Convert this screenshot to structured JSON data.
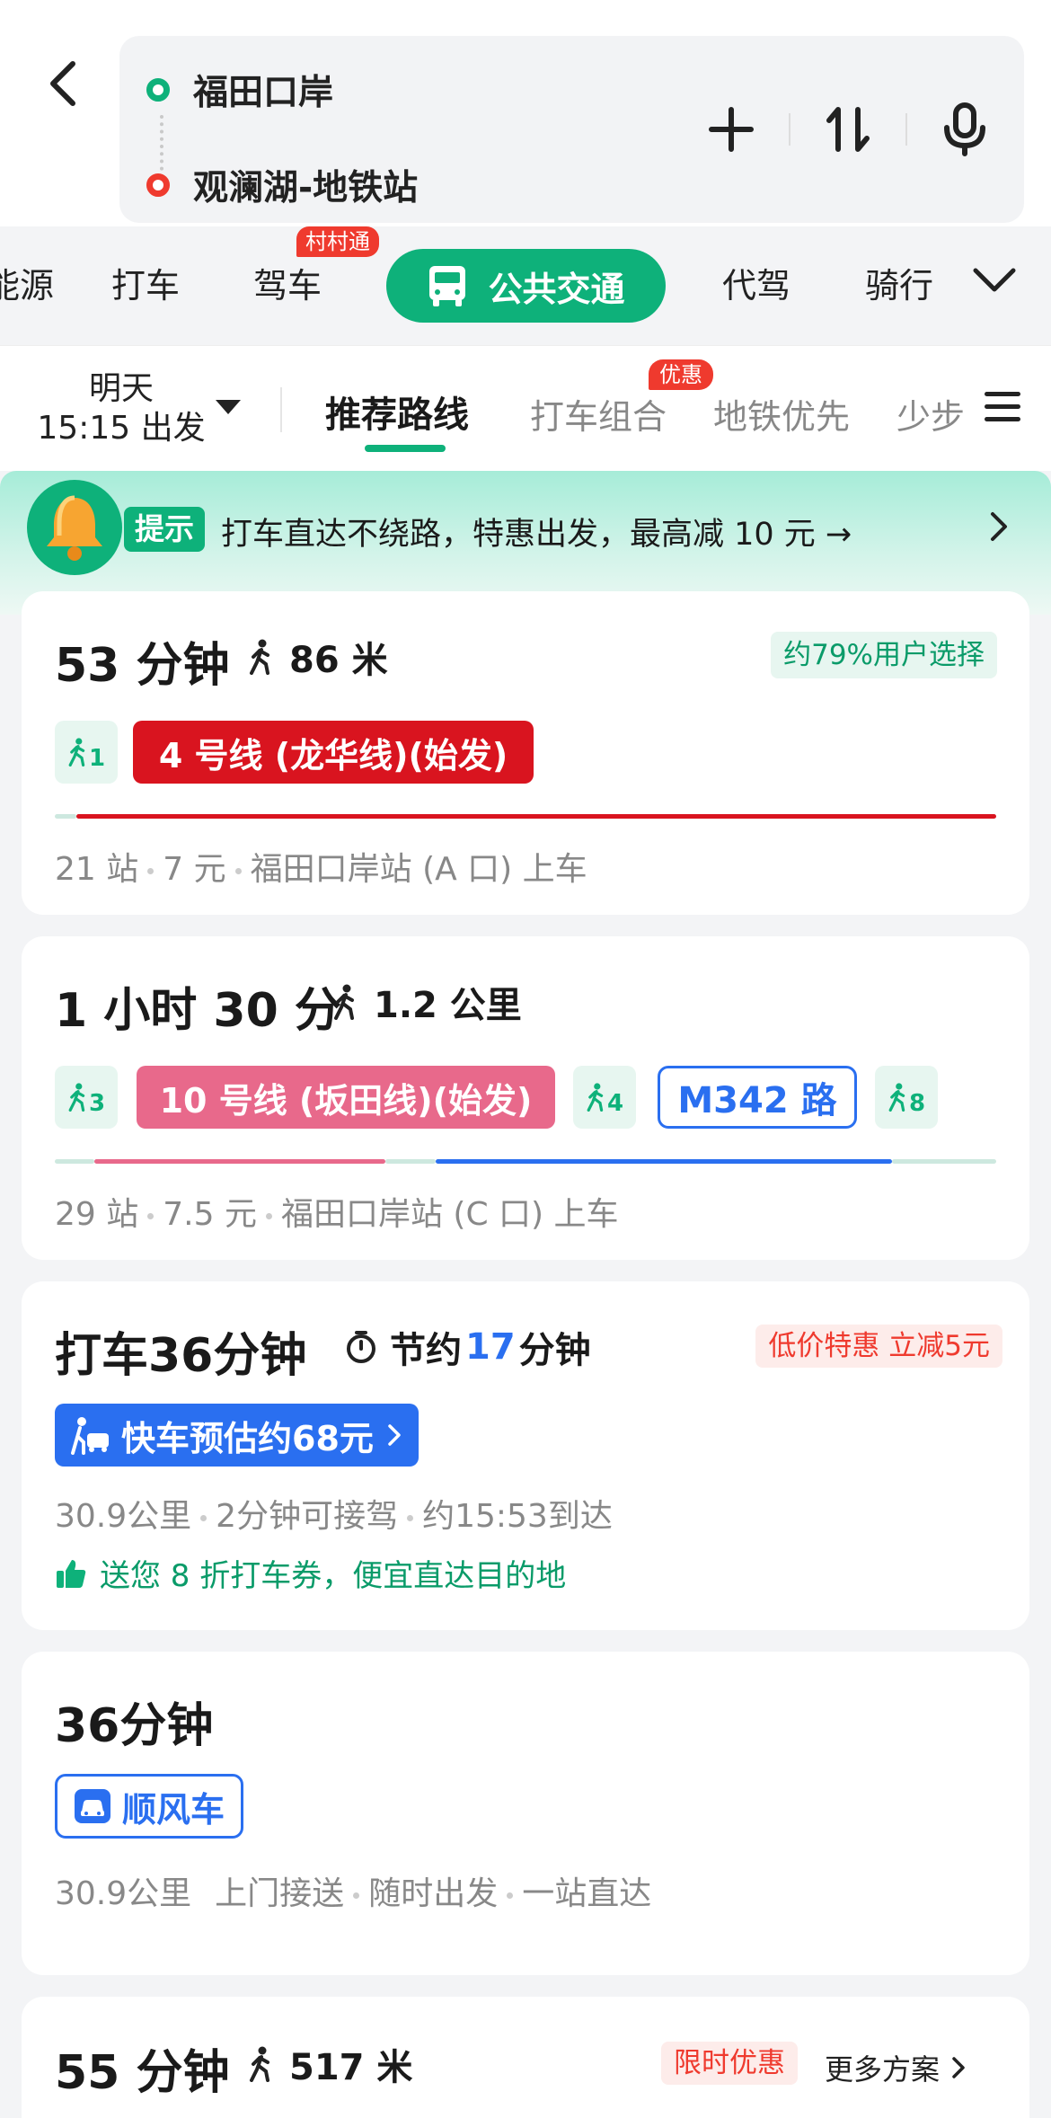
{
  "header": {
    "origin": "福田口岸",
    "destination": "观澜湖-地铁站",
    "icons": [
      "back-icon",
      "plus-icon",
      "swap-icon",
      "mic-icon"
    ]
  },
  "modes": {
    "items": [
      "能源",
      "打车",
      "驾车",
      "公共交通",
      "代驾",
      "骑行"
    ],
    "active": "公共交通",
    "badge": "村村通"
  },
  "filter": {
    "depart_day": "明天",
    "depart_time": "15:15 出发",
    "tabs": [
      "推荐路线",
      "打车组合",
      "地铁优先",
      "少步"
    ],
    "active_tab": "推荐路线",
    "badge": "优惠"
  },
  "promo": {
    "label": "提示",
    "text": "打车直达不绕路，特惠出发，最高减 10 元 →"
  },
  "routes": [
    {
      "duration": "53 分钟",
      "walk": "86 米",
      "choice_badge": "约79%用户选择",
      "walk_chip": "1",
      "line": "4 号线 (龙华线)(始发)",
      "line_color": "#d9141f",
      "stations": "21 站",
      "fare": "7 元",
      "boarding": "福田口岸站 (A 口) 上车"
    },
    {
      "duration": "1 小时 30 分",
      "walk": "1.2 公里",
      "walk_chip_1": "3",
      "line": "10 号线 (坂田线)(始发)",
      "line_color": "#e8698b",
      "walk_chip_2": "4",
      "bus": "M342 路",
      "bus_color": "#2a6ff0",
      "walk_chip_3": "8",
      "stations": "29 站",
      "fare": "7.5 元",
      "boarding": "福田口岸站 (C 口) 上车"
    }
  ],
  "taxi": {
    "title": "打车36分钟",
    "save_prefix": "节约",
    "save_minutes": "17",
    "save_suffix": "分钟",
    "badge": "低价特惠 立减5元",
    "button": "快车预估约68元",
    "distance": "30.9公里",
    "pickup": "2分钟可接驾",
    "arrival": "约15:53到达",
    "note": "送您 8 折打车券，便宜直达目的地"
  },
  "carpool": {
    "title": "36分钟",
    "chip": "顺风车",
    "distance": "30.9公里",
    "feature_1": "上门接送",
    "feature_2": "随时出发",
    "feature_3": "一站直达"
  },
  "last_route": {
    "duration": "55 分钟",
    "walk": "517 米",
    "badge": "限时优惠",
    "more": "更多方案"
  }
}
